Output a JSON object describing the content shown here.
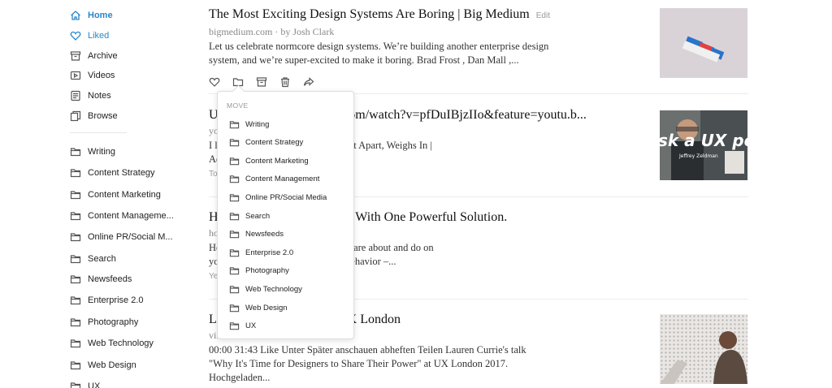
{
  "sidebar": {
    "nav": [
      {
        "label": "Home",
        "icon": "home-icon"
      },
      {
        "label": "Liked",
        "icon": "heart-icon"
      },
      {
        "label": "Archive",
        "icon": "archive-icon"
      },
      {
        "label": "Videos",
        "icon": "video-icon"
      },
      {
        "label": "Notes",
        "icon": "notes-icon"
      },
      {
        "label": "Browse",
        "icon": "browse-icon"
      }
    ],
    "folders": [
      "Writing",
      "Content Strategy",
      "Content Marketing",
      "Content Manageme...",
      "Online PR/Social M...",
      "Search",
      "Newsfeeds",
      "Enterprise 2.0",
      "Photography",
      "Web Technology",
      "Web Design",
      "UX"
    ]
  },
  "articles": [
    {
      "title": "The Most Exciting Design Systems Are Boring | Big Medium",
      "edit_label": "Edit",
      "meta": "bigmedium.com · by Josh Clark",
      "excerpt": "Let us celebrate normcore design systems. We’re building another enterprise design system, and we’re super-excited to make it boring. Brad Frost , Dan Mall ,..."
    },
    {
      "title": "U... https://www.youtube.com/watch?v=pfDuIBjzIIo&feature=youtu.b...",
      "meta": "yo...",
      "excerpt_1": "I l... Expert: Jeffrey Zeldman, A List Apart, Weighs In |",
      "excerpt_2": "Ad...",
      "tiny": "To..."
    },
    {
      "title": "H... - Connect All The Dots With One Powerful Solution.",
      "meta": "ho...",
      "excerpt_1": "Ho... understand what users want, care about and do on",
      "excerpt_2": "yo... eir clicks, taps and scrolling behavior –...",
      "tiny": "Ye..."
    },
    {
      "title": "L... UX London 2017 in UX London",
      "meta": "vi...",
      "excerpt": "00:00 31:43 Like Unter Später anschauen abheften Teilen Lauren Currie's talk \"Why It's Time for Designers to Share Their Power\" at UX London 2017. Hochgeladen..."
    }
  ],
  "move_menu": {
    "heading": "MOVE",
    "items": [
      "Writing",
      "Content Strategy",
      "Content Marketing",
      "Content Management",
      "Online PR/Social Media",
      "Search",
      "Newsfeeds",
      "Enterprise 2.0",
      "Photography",
      "Web Technology",
      "Web Design",
      "UX"
    ]
  },
  "thumbnails": {
    "video_overlay": "sk a UX pe",
    "video_caption": "Jeffrey Zeldman"
  },
  "colors": {
    "accent": "#2a86c9",
    "icon": "#555555"
  }
}
